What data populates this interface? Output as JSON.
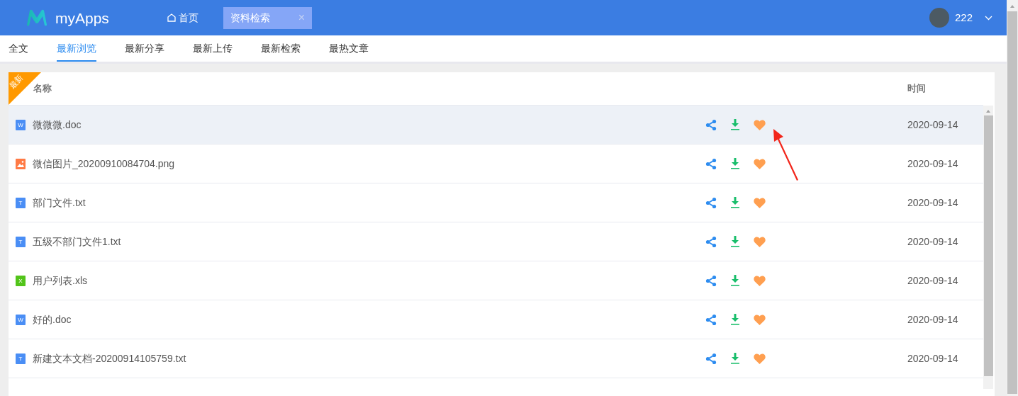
{
  "header": {
    "logo_text": "myApps",
    "nav": [
      {
        "label": "首页",
        "kind": "home"
      }
    ],
    "open_tabs": [
      {
        "label": "资料检索",
        "close": "×",
        "selected": true
      }
    ],
    "user": {
      "name": "222"
    }
  },
  "tabs": [
    {
      "label": "全文",
      "selected": false
    },
    {
      "label": "最新浏览",
      "selected": true
    },
    {
      "label": "最新分享",
      "selected": false
    },
    {
      "label": "最新上传",
      "selected": false
    },
    {
      "label": "最新检索",
      "selected": false
    },
    {
      "label": "最热文章",
      "selected": false
    }
  ],
  "table": {
    "ribbon": "最新",
    "columns": [
      "名称",
      "时间"
    ],
    "rows": [
      {
        "kind": "word",
        "letter": "W",
        "name": "微微微.doc",
        "date": "2020-09-14",
        "selected": true
      },
      {
        "kind": "image",
        "name": "微信图片_20200910084704.png",
        "date": "2020-09-14",
        "selected": false
      },
      {
        "kind": "text",
        "letter": "T",
        "name": "部门文件.txt",
        "date": "2020-09-14",
        "selected": false
      },
      {
        "kind": "text",
        "letter": "T",
        "name": "五级不部门文件1.txt",
        "date": "2020-09-14",
        "selected": false
      },
      {
        "kind": "excel",
        "letter": "X",
        "name": "用户列表.xls",
        "date": "2020-09-14",
        "selected": false
      },
      {
        "kind": "word",
        "letter": "W",
        "name": "好的.doc",
        "date": "2020-09-14",
        "selected": false
      },
      {
        "kind": "text",
        "letter": "T",
        "name": "新建文本文档-20200914105759.txt",
        "date": "2020-09-14",
        "selected": false
      }
    ]
  }
}
